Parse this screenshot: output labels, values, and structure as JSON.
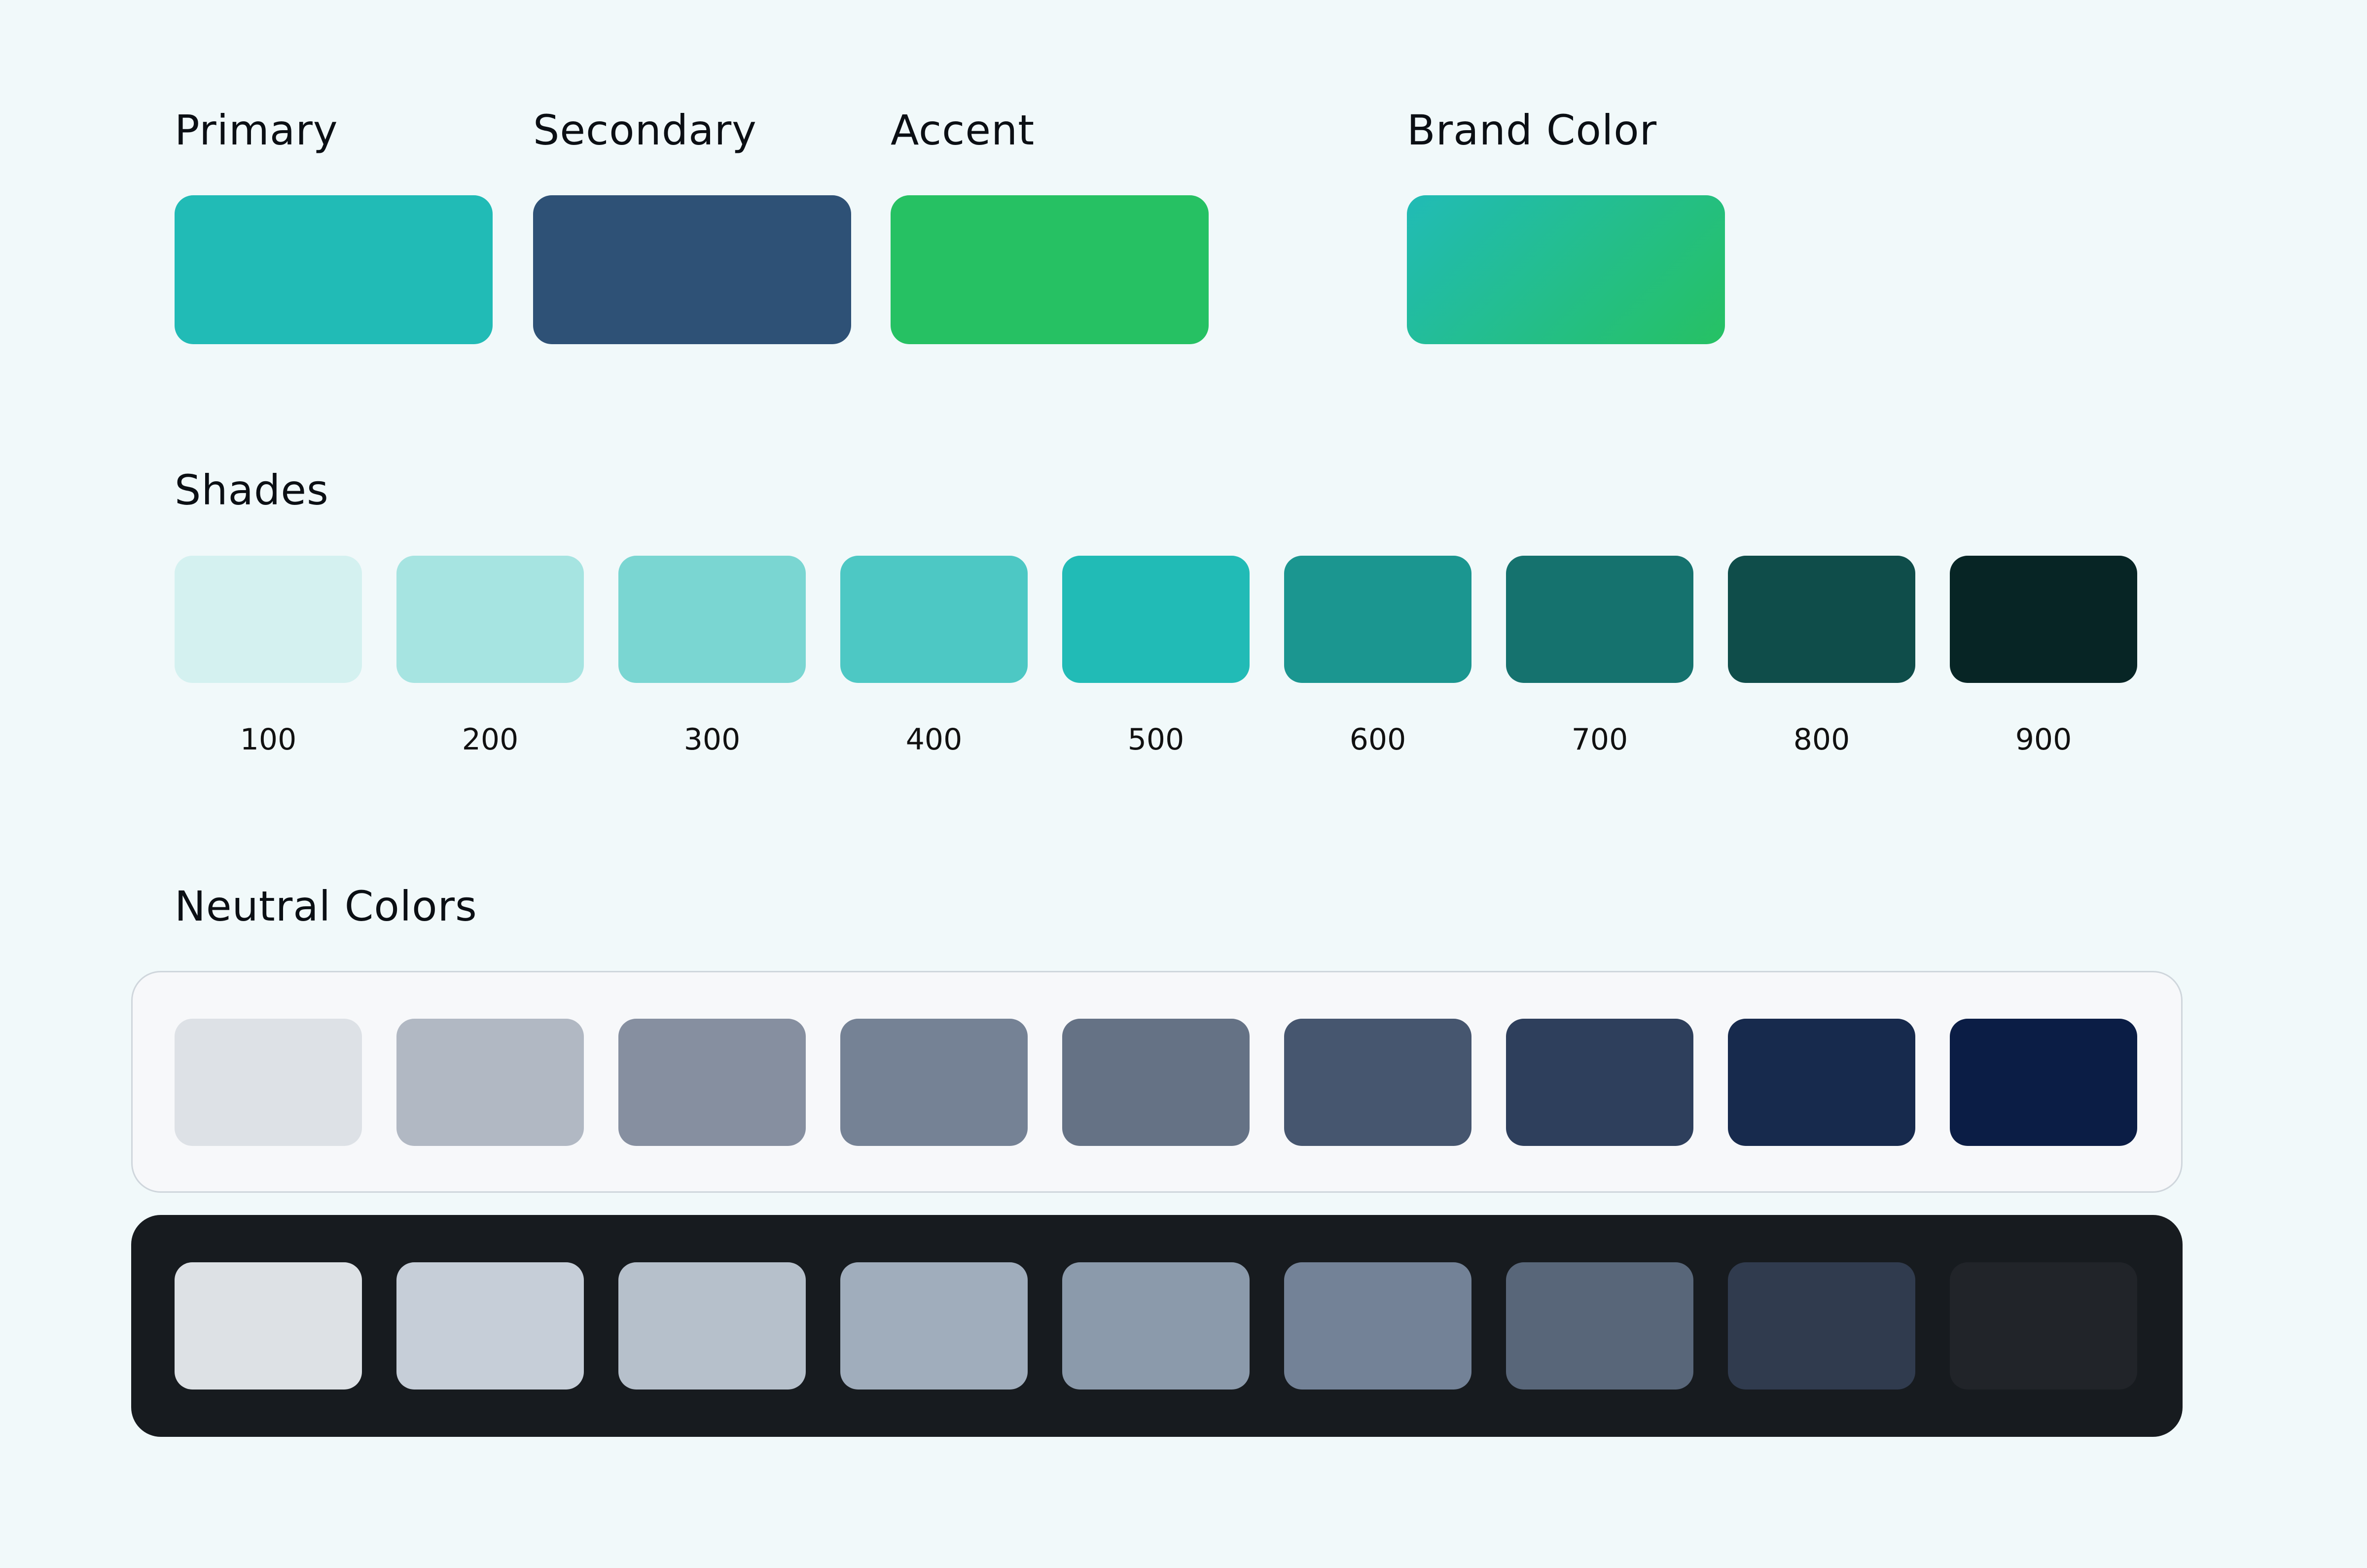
{
  "main_colors": [
    {
      "label": "Primary",
      "color": "#21bbb6"
    },
    {
      "label": "Secondary",
      "color": "#2e5176"
    },
    {
      "label": "Accent",
      "color": "#26c163"
    }
  ],
  "brand": {
    "label": "Brand Color",
    "gradient_from": "#21bbb6",
    "gradient_to": "#26c163"
  },
  "shades": {
    "title": "Shades",
    "items": [
      {
        "label": "100",
        "color": "#d4f1f0"
      },
      {
        "label": "200",
        "color": "#a6e4e1"
      },
      {
        "label": "300",
        "color": "#7ad6d2"
      },
      {
        "label": "400",
        "color": "#4dc8c4"
      },
      {
        "label": "500",
        "color": "#21bbb6"
      },
      {
        "label": "600",
        "color": "#1b9690"
      },
      {
        "label": "700",
        "color": "#15726e"
      },
      {
        "label": "800",
        "color": "#0f4d4a"
      },
      {
        "label": "900",
        "color": "#072525"
      }
    ]
  },
  "neutrals": {
    "title": "Neutral Colors",
    "light_row": [
      "#dde1e6",
      "#b1b8c3",
      "#868fa0",
      "#758295",
      "#657285",
      "#46566f",
      "#2e3f5c",
      "#172a4d",
      "#0b1d45"
    ],
    "dark_row": [
      "#dde1e5",
      "#c6ced8",
      "#b6c0cb",
      "#a0adbc",
      "#8b9aab",
      "#738297",
      "#586679",
      "#303b4e",
      "#212429"
    ]
  }
}
